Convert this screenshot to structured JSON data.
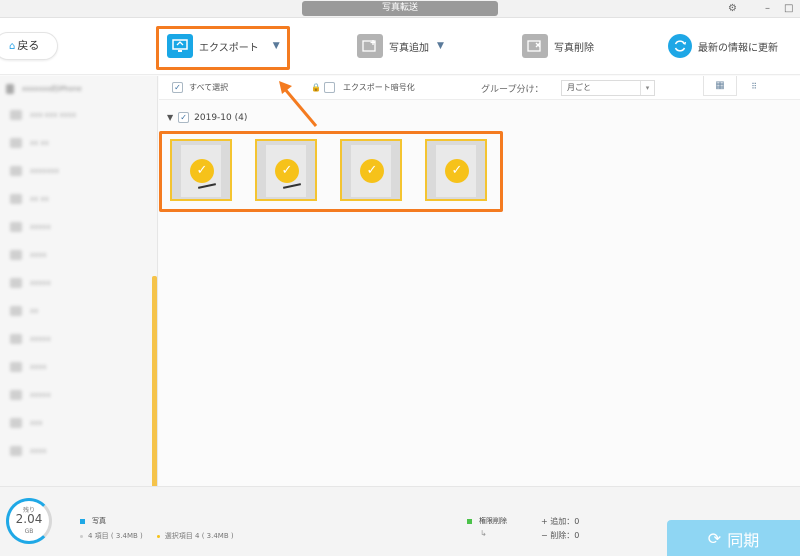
{
  "window": {
    "title": "写真転送",
    "gear": "⚙",
    "minimize": "–",
    "maximize": "□"
  },
  "toolbar": {
    "back_label": "戻る",
    "export_label": "エクスポート",
    "add_label": "写真追加",
    "delete_label": "写真削除",
    "refresh_label": "最新の情報に更新"
  },
  "sidebar": {
    "device": "xxxxxxx的iPhone",
    "items": [
      {
        "label": "xxx-xxx xxxx"
      },
      {
        "label": "xx xx"
      },
      {
        "label": "xxxxxxx"
      },
      {
        "label": "xx xx"
      },
      {
        "label": "xxxxx"
      },
      {
        "label": "xxxx"
      },
      {
        "label": "xxxxx"
      },
      {
        "label": "xx"
      },
      {
        "label": "xxxxx"
      },
      {
        "label": "xxxx"
      },
      {
        "label": "xxxxx"
      },
      {
        "label": "xxx"
      },
      {
        "label": "xxxx"
      }
    ]
  },
  "filter": {
    "select_all": "すべて選択",
    "encrypt": "エクスポート暗号化",
    "group_label": "グループ分け：",
    "group_value": "月ごと"
  },
  "group": {
    "title": "2019-10 (4)"
  },
  "photos": [
    {
      "selected": true,
      "scribble": true
    },
    {
      "selected": true,
      "scribble": true
    },
    {
      "selected": true,
      "scribble": false
    },
    {
      "selected": true,
      "scribble": false
    }
  ],
  "status": {
    "remaining_label": "残り",
    "remaining_value": "2.04",
    "remaining_unit": "GB",
    "category": "写真",
    "items_total": "4 項目 ( 3.4MB )",
    "items_selected": "選択項目 4 ( 3.4MB )",
    "perm_delete": "権限削除",
    "added": "+ 追加：0",
    "deleted": "− 削除：0",
    "sync_label": "同期"
  },
  "colors": {
    "accent": "#19a7e6",
    "highlight": "#f47b20",
    "check": "#f6c21a",
    "photos_legend": "#1fa8e6",
    "perm_legend": "#4cc24a",
    "selected_dot": "#f6c21a"
  }
}
